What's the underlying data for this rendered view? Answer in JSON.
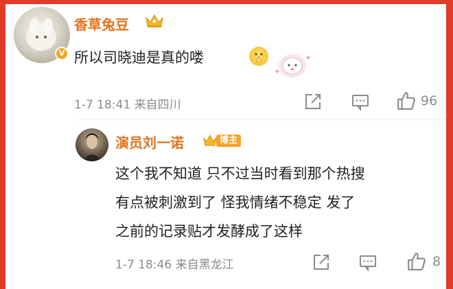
{
  "comment": {
    "username": "香草兔豆",
    "text": "所以司晓迪是真的喽",
    "meta": "1-7 18:41 来自四川",
    "like_count": "96",
    "icons": [
      "avatar",
      "verified-v-icon",
      "crown-badge-icon",
      "pray-emoji",
      "sticker",
      "share-icon",
      "comment-icon",
      "like-icon"
    ]
  },
  "reply": {
    "username": "演员刘一诺",
    "badge": "博主",
    "lines": [
      "这个我不知道 只不过当时看到那个热搜",
      "有点被刺激到了 怪我情绪不稳定 发了",
      "之前的记录贴才发酵成了这样"
    ],
    "meta": "1-7 18:46 来自黑龙江",
    "like_count": "8"
  },
  "colors": {
    "frame": "#e23b2b",
    "username": "#e2731d",
    "meta": "#8a8a8a",
    "badge": "#f7a22c"
  }
}
